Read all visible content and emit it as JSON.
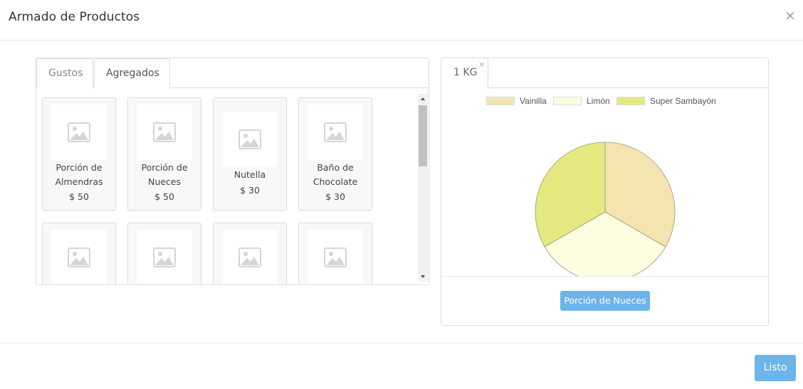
{
  "modal": {
    "title": "Armado de Productos",
    "close_glyph": "×"
  },
  "left_tabs": [
    {
      "label": "Gustos",
      "active": false
    },
    {
      "label": "Agregados",
      "active": true
    }
  ],
  "products": [
    {
      "name_line1": "Porción de",
      "name_line2": "Almendras",
      "price": "$ 50"
    },
    {
      "name_line1": "Porción de",
      "name_line2": "Nueces",
      "price": "$ 50"
    },
    {
      "name_line1": "Nutella",
      "name_line2": "",
      "price": "$ 30"
    },
    {
      "name_line1": "Baño de",
      "name_line2": "Chocolate",
      "price": "$ 30"
    },
    {
      "name_line1": "",
      "name_line2": "",
      "price": ""
    },
    {
      "name_line1": "",
      "name_line2": "",
      "price": ""
    },
    {
      "name_line1": "",
      "name_line2": "",
      "price": ""
    },
    {
      "name_line1": "",
      "name_line2": "",
      "price": ""
    }
  ],
  "right_tab": {
    "label": "1 KG",
    "close_glyph": "×"
  },
  "chart_data": {
    "type": "pie",
    "labels": [
      "Vainilla",
      "Limón",
      "Super Sambayón"
    ],
    "values": [
      1,
      1,
      1
    ],
    "colors": [
      "#f3e4b0",
      "#fdfde0",
      "#e4ea7f"
    ],
    "legend_position": "top"
  },
  "selected_addon": {
    "label": "Porción de Nueces"
  },
  "footer": {
    "done_label": "Listo"
  },
  "colors": {
    "accent": "#6cb4ea"
  }
}
